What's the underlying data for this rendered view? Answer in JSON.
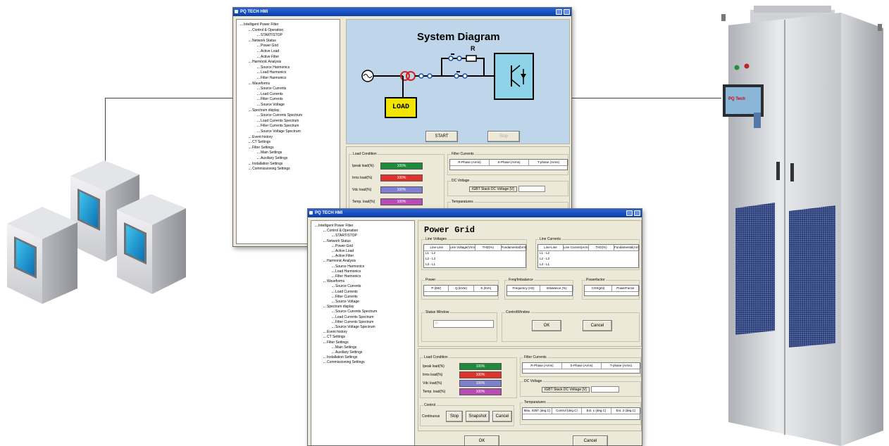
{
  "window1": {
    "title": "PQ TECH HMI",
    "tree": [
      "Intelligent Power Filter",
      "Control & Operation",
      "START/STOP",
      "Network Status",
      "Power Grid",
      "Active Load",
      "Active Filter",
      "Harmonic Analysis",
      "Source Harmonics",
      "Load Harmonics",
      "Filter Harmonics",
      "Waveforms",
      "Source Currents",
      "Load Currents",
      "Filter Currents",
      "Source Voltage",
      "Spectrum display",
      "Source Currents Spectrum",
      "Load Currents Spectrum",
      "Filter Currents Spectrum",
      "Source Voltage Spectrum",
      "Event history",
      "CT Settings",
      "Filter Settings",
      "Main Settings",
      "Auxiliary Settings",
      "Installation Settings",
      "Commissioning Settings"
    ],
    "diagram_title": "System Diagram",
    "resistor_label": "R",
    "load_label": "LOAD",
    "start_label": "START",
    "stop_label": "Stop",
    "load_condition": {
      "title": "Load Condition",
      "rows": [
        {
          "label": "Ipeak load(%)",
          "value": "100%",
          "color": "#1e8a3a"
        },
        {
          "label": "Irms load(%)",
          "value": "100%",
          "color": "#e0322a"
        },
        {
          "label": "Vdc load(%)",
          "value": "100%",
          "color": "#7f7fcf"
        },
        {
          "label": "Temp. load(%)",
          "value": "100%",
          "color": "#b94bb5"
        }
      ]
    },
    "filter_currents": {
      "title": "Filter Currents",
      "cols": [
        "R-Phase (Arms)",
        "S-Phase (Arms)",
        "T-phase (Arms)"
      ]
    },
    "dc_voltage": {
      "title": "DC Voltage",
      "field": "IGBT Stack DC Voltage [V]"
    },
    "temperatures_title": "Temparatures"
  },
  "window2": {
    "title": "PQ TECH HMI",
    "tree": [
      "Intelligent Power Filter",
      "Control & Operation",
      "START/STOP",
      "Network Status",
      "Power Grid",
      "Active Load",
      "Active Filter",
      "Harmonic Analysis",
      "Source Harmonics",
      "Load Harmonics",
      "Filter Harmonics",
      "Waveforms",
      "Source Currents",
      "Load Currents",
      "Filter Currents",
      "Source Voltage",
      "Spectrum display",
      "Source Currents Spectrum",
      "Load Currents Spectrum",
      "Filter Currents Spectrum",
      "Source Voltage Spectrum",
      "Event history",
      "CT Settings",
      "Filter Settings",
      "Main Settings",
      "Auxiliary Settings",
      "Installation Settings",
      "Commissioning Settings"
    ],
    "page_title": "Power Grid",
    "line_voltages": {
      "title": "Line Voltages",
      "cols": [
        "Line-Line",
        "Line Voltage(Vrms)",
        "THD(%)",
        "Fundamental(Vrms)"
      ],
      "rows": [
        "L1 - L2",
        "L2 - L3",
        "L3 - L1"
      ]
    },
    "line_currents": {
      "title": "Line Currents",
      "cols": [
        "Line-Line",
        "Line Current(Arms)",
        "THD(%)",
        "Fundamental(Arms)"
      ],
      "rows": [
        "L1 - L2",
        "L2 - L3",
        "L3 - L1"
      ]
    },
    "power": {
      "title": "Power",
      "cols": [
        "P (kW)",
        "Q (kVar)",
        "S (kVA)"
      ]
    },
    "freq": {
      "title": "Freq/Imbalance",
      "cols": [
        "Frequency (Hz)",
        "Imbalance (%)"
      ]
    },
    "pf": {
      "title": "Powerfactor",
      "cols": [
        "COS(phi)",
        "PowerFactor"
      ]
    },
    "status_window": {
      "title": "Status Window",
      "value": "0"
    },
    "control_window": {
      "title": "ControlWindow",
      "ok": "OK",
      "cancel": "Cancel"
    },
    "load_condition": {
      "title": "Load Condition",
      "rows": [
        {
          "label": "Ipeak load(%)",
          "value": "100%",
          "color": "#1e8a3a"
        },
        {
          "label": "Irms load(%)",
          "value": "100%",
          "color": "#e0322a"
        },
        {
          "label": "Vdc load(%)",
          "value": "100%",
          "color": "#7f7fcf"
        },
        {
          "label": "Temp. load(%)",
          "value": "100%",
          "color": "#b94bb5"
        }
      ]
    },
    "filter_currents": {
      "title": "Filter Currents",
      "cols": [
        "R-Phase (Arms)",
        "S-Phase (Arms)",
        "T-phase (Arms)"
      ]
    },
    "dc_voltage": {
      "title": "DC Voltage",
      "field": "IGBT Stack DC Voltage [V]"
    },
    "temperatures": {
      "title": "Temparatures",
      "cols": [
        "Max. IGBT (deg.C)",
        "Control (deg.C)",
        "Ext. 1 (deg.C)",
        "Ext. 2 (deg.C)"
      ]
    },
    "control": {
      "title": "Control",
      "buttons": [
        "Continuous",
        "Stop",
        "Snapshot",
        "Cancel"
      ]
    },
    "ok_label": "OK",
    "cancel_label": "Cancel"
  },
  "cabinet": {
    "display_brand": "PQ Tech"
  },
  "colors": {
    "title_bar": "#0a3fa8",
    "diagram_bg": "#bfd6ea",
    "load_box": "#f2e600",
    "inverter_box": "#8fd3e8",
    "cabinet": "#d4d7db"
  }
}
